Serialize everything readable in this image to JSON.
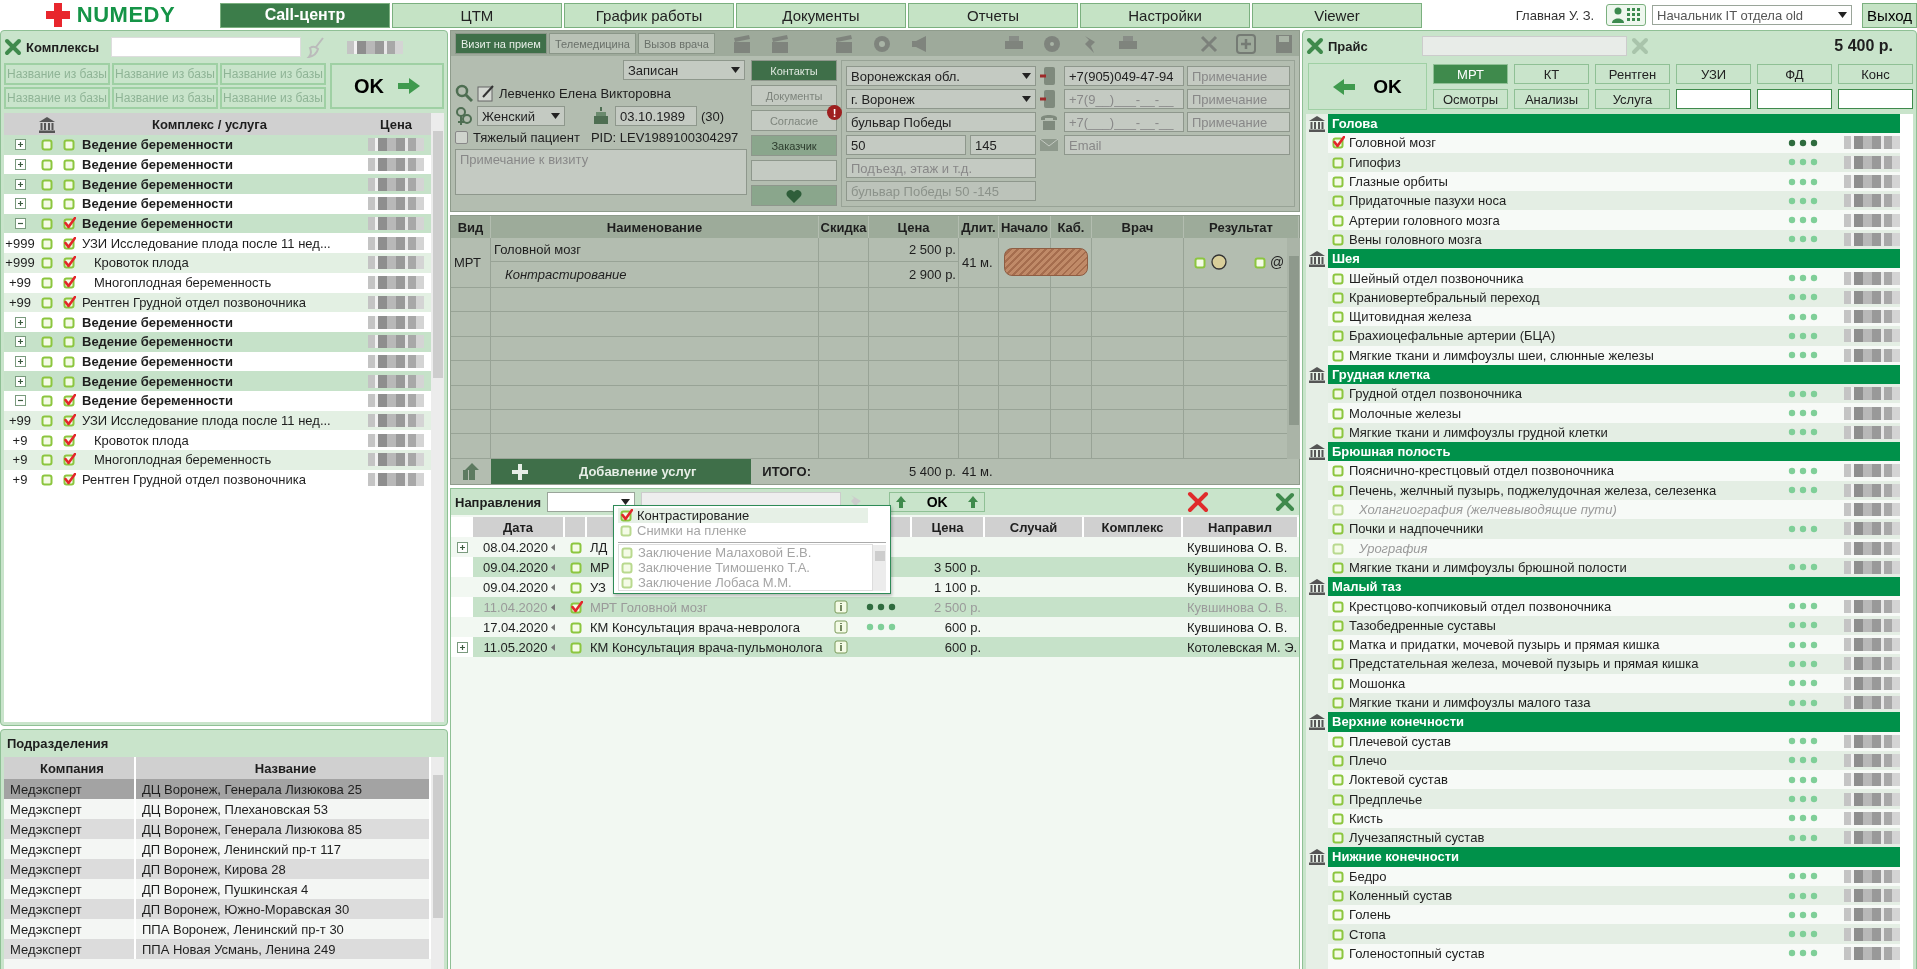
{
  "header": {
    "logo": "NUMEDY",
    "nav": [
      {
        "label": "Call-центр",
        "selected": true
      },
      {
        "label": "ЦТМ",
        "selected": false
      },
      {
        "label": "График работы",
        "selected": false
      },
      {
        "label": "Документы",
        "selected": false
      },
      {
        "label": "Отчеты",
        "selected": false
      },
      {
        "label": "Настройки",
        "selected": false
      },
      {
        "label": "Viewer",
        "selected": false
      }
    ],
    "user": "Главная У. З.",
    "role": "Начальник IT отдела old",
    "logout": "Выход"
  },
  "complexes": {
    "title": "Комплексы",
    "quick_buttons": [
      "Название из базы",
      "Название из базы",
      "Название из базы",
      "Название из базы",
      "Название из базы",
      "Название из базы"
    ],
    "ok": "OK",
    "columns": [
      "Комплекс / услуга",
      "Цена"
    ],
    "rows": [
      {
        "kind": "group",
        "name": "Ведение беременности",
        "checked": false,
        "expanded": false
      },
      {
        "kind": "group",
        "name": "Ведение беременности",
        "checked": false,
        "expanded": false
      },
      {
        "kind": "group",
        "name": "Ведение беременности",
        "checked": false,
        "expanded": false
      },
      {
        "kind": "group",
        "name": "Ведение беременности",
        "checked": false,
        "expanded": false
      },
      {
        "kind": "group",
        "name": "Ведение беременности",
        "checked": true,
        "expanded": true,
        "children": [
          {
            "kind": "service",
            "count": "+999",
            "name": "УЗИ Исследование плода после 11 нед...",
            "checked": true,
            "children": [
              {
                "kind": "service",
                "count": "+999",
                "name": "Кровоток плода",
                "checked": true
              },
              {
                "kind": "service",
                "count": "+99",
                "name": "Многоплодная беременность",
                "checked": true
              }
            ]
          },
          {
            "kind": "service",
            "count": "+99",
            "name": "Рентген Грудной отдел позвоночника",
            "checked": true
          }
        ]
      },
      {
        "kind": "group",
        "name": "Ведение беременности",
        "checked": false,
        "expanded": false
      },
      {
        "kind": "group",
        "name": "Ведение беременности",
        "checked": false,
        "expanded": false
      },
      {
        "kind": "group",
        "name": "Ведение беременности",
        "checked": false,
        "expanded": false
      },
      {
        "kind": "group",
        "name": "Ведение беременности",
        "checked": false,
        "expanded": false
      },
      {
        "kind": "group",
        "name": "Ведение беременности",
        "checked": true,
        "expanded": true,
        "children": [
          {
            "kind": "service",
            "count": "+99",
            "name": "УЗИ Исследование плода после 11 нед...",
            "checked": true,
            "children": [
              {
                "kind": "service",
                "count": "+9",
                "name": "Кровоток плода",
                "checked": true
              },
              {
                "kind": "service",
                "count": "+9",
                "name": "Многоплодная беременность",
                "checked": true
              }
            ]
          },
          {
            "kind": "service",
            "count": "+9",
            "name": "Рентген Грудной отдел позвоночника",
            "checked": true
          }
        ]
      }
    ]
  },
  "divisions": {
    "title": "Подразделения",
    "columns": [
      "Компания",
      "Название"
    ],
    "rows": [
      {
        "company": "Медэксперт",
        "name": "ДЦ Воронеж, Генерала Лизюкова 25",
        "selected": true
      },
      {
        "company": "Медэксперт",
        "name": "ДЦ Воронеж, Плехановская 53",
        "selected": false
      },
      {
        "company": "Медэксперт",
        "name": "ДЦ Воронеж, Генерала Лизюкова 85",
        "selected": false
      },
      {
        "company": "Медэксперт",
        "name": "ДП Воронеж, Ленинский пр-т 117",
        "selected": false
      },
      {
        "company": "Медэксперт",
        "name": "ДП Воронеж, Кирова 28",
        "selected": false
      },
      {
        "company": "Медэксперт",
        "name": "ДП Воронеж, Пушкинская 4",
        "selected": false
      },
      {
        "company": "Медэксперт",
        "name": "ДП Воронеж, Южно-Моравская 30",
        "selected": false
      },
      {
        "company": "Медэксперт",
        "name": "ППА Воронеж, Ленинский пр-т 30",
        "selected": false
      },
      {
        "company": "Медэксперт",
        "name": "ППА Новая Усмань, Ленина 249",
        "selected": false
      }
    ]
  },
  "visit": {
    "tabs": [
      {
        "label": "Визит на прием",
        "selected": true
      },
      {
        "label": "Телемедицина",
        "selected": false
      },
      {
        "label": "Вызов врача",
        "selected": false
      }
    ],
    "status": "Записан",
    "patient": "Левченко Елена Викторовна",
    "gender": "Женский",
    "birth_date": "03.10.1989",
    "age": "(30)",
    "heavy_patient": {
      "label": "Тяжелый пациент",
      "checked": false
    },
    "pid": "PID: LEV1989100304297",
    "note_placeholder": "Примечание к визиту",
    "side_buttons": [
      {
        "kind": "tab",
        "label": "Контакты",
        "selected": true
      },
      {
        "kind": "tab",
        "label": "Документы",
        "selected": false
      },
      {
        "kind": "tab",
        "label": "Согласие",
        "selected": false,
        "alert": "!"
      },
      {
        "kind": "action",
        "label": "Заказчик"
      }
    ],
    "address": {
      "region": "Воронежская обл.",
      "city": "г. Воронеж",
      "street": "бульвар Победы",
      "house": "50",
      "apartment": "145",
      "entrance_placeholder": "Подъезд, этаж и т.д.",
      "full": "бульвар Победы 50 -145"
    },
    "contacts": [
      {
        "kind": "mobile",
        "value": "+7(905)049-47-94",
        "note_placeholder": "Примечание"
      },
      {
        "kind": "mobile",
        "placeholder": "+7(9__)___-__-__",
        "note_placeholder": "Примечание"
      },
      {
        "kind": "landline",
        "placeholder": "+7(___)___-__-__",
        "note_placeholder": "Примечание"
      }
    ],
    "email_placeholder": "Email"
  },
  "services": {
    "columns": [
      "Вид",
      "Наименование",
      "Скидка",
      "Цена",
      "Длит.",
      "Начало",
      "Каб.",
      "Врач",
      "Результат"
    ],
    "rows": [
      {
        "type": "МРТ",
        "name": "Головной мозг",
        "price": "2 500 р.",
        "duration": "41 м.",
        "booked": true,
        "email_mark": "@",
        "options": [
          {
            "name": "Контрастирование",
            "price": "2 900 р."
          }
        ]
      }
    ],
    "add_button": "Добавление услуг",
    "total_label": "ИТОГО:",
    "total": "5 400 р.",
    "total_duration": "41 м."
  },
  "directions": {
    "title": "Направления",
    "ok": "OK",
    "columns": {
      "date": "Дата",
      "price": "Цена",
      "case": "Случай",
      "complex": "Комплекс",
      "referrer": "Направил"
    },
    "rows": [
      {
        "date": "08.04.2020",
        "expandable": true,
        "checked": false,
        "name": "ЛД",
        "referrer": "Кувшинова О. В."
      },
      {
        "date": "09.04.2020",
        "checked": false,
        "name": "МР",
        "price": "3 500 р.",
        "referrer": "Кувшинова О. В."
      },
      {
        "date": "09.04.2020",
        "checked": false,
        "name": "УЗ",
        "price": "1 100 р.",
        "referrer": "Кувшинова О. В."
      },
      {
        "date": "11.04.2020",
        "checked": true,
        "disabled": true,
        "name": "МРТ Головной мозг",
        "info": true,
        "dots_active": true,
        "price": "2 500 р.",
        "referrer": "Кувшинова О. В."
      },
      {
        "date": "17.04.2020",
        "checked": false,
        "name": "КМ Консультация врача-невролога",
        "info": true,
        "dots_active": false,
        "price": "600 р.",
        "referrer": "Кувшинова О. В."
      },
      {
        "date": "11.05.2020",
        "expandable": true,
        "checked": false,
        "name": "КМ Консультация врача-пульмонолога",
        "info": true,
        "price": "600 р.",
        "referrer": "Котолевская М. Э."
      }
    ],
    "popup": {
      "options": [
        {
          "label": "Контрастирование",
          "checked": true,
          "disabled": false
        },
        {
          "label": "Снимки на пленке",
          "checked": false,
          "disabled": true
        }
      ],
      "reports": [
        {
          "label": "Заключение Малаховой Е.В.",
          "checked": false,
          "disabled": true
        },
        {
          "label": "Заключение Тимошенко Т.А.",
          "checked": false,
          "disabled": true
        },
        {
          "label": "Заключение Лобаса М.М.",
          "checked": false,
          "disabled": true
        }
      ]
    }
  },
  "price": {
    "title": "Прайс",
    "total": "5 400 р.",
    "ok": "OK",
    "tabs": [
      {
        "label": "МРТ",
        "selected": true
      },
      {
        "label": "КТ",
        "selected": false
      },
      {
        "label": "Рентген",
        "selected": false
      },
      {
        "label": "УЗИ",
        "selected": false
      },
      {
        "label": "ФД",
        "selected": false
      },
      {
        "label": "Конс",
        "selected": false
      },
      {
        "label": "Осмотры",
        "selected": false
      },
      {
        "label": "Анализы",
        "selected": false
      },
      {
        "label": "Услуга",
        "selected": false
      }
    ],
    "sections": [
      {
        "title": "Голова",
        "items": [
          {
            "kind": "service",
            "name": "Головной мозг",
            "checked": true,
            "dots_active": true
          },
          {
            "kind": "service",
            "name": "Гипофиз",
            "checked": false,
            "dots_active": false
          },
          {
            "kind": "service",
            "name": "Глазные орбиты",
            "checked": false,
            "dots_active": false
          },
          {
            "kind": "service",
            "name": "Придаточные пазухи носа",
            "checked": false,
            "dots_active": false
          },
          {
            "kind": "service",
            "name": "Артерии головного мозга",
            "checked": false,
            "dots_active": false
          },
          {
            "kind": "service",
            "name": "Вены головного мозга",
            "checked": false,
            "dots_active": false
          }
        ]
      },
      {
        "title": "Шея",
        "items": [
          {
            "kind": "service",
            "name": "Шейный отдел позвоночника",
            "checked": false,
            "dots_active": false
          },
          {
            "kind": "service",
            "name": "Краниовертебральный переход",
            "checked": false,
            "dots_active": false
          },
          {
            "kind": "service",
            "name": "Щитовидная железа",
            "checked": false,
            "dots_active": false
          },
          {
            "kind": "service",
            "name": "Брахиоцефальные артерии (БЦА)",
            "checked": false,
            "dots_active": false
          },
          {
            "kind": "service",
            "name": "Мягкие ткани и лимфоузлы шеи, слюнные железы",
            "checked": false,
            "dots_active": false
          }
        ]
      },
      {
        "title": "Грудная клетка",
        "items": [
          {
            "kind": "service",
            "name": "Грудной отдел позвоночника",
            "checked": false,
            "dots_active": false
          },
          {
            "kind": "service",
            "name": "Молочные железы",
            "checked": false,
            "dots_active": false
          },
          {
            "kind": "service",
            "name": "Мягкие ткани и лимфоузлы грудной клетки",
            "checked": false,
            "dots_active": false
          }
        ]
      },
      {
        "title": "Брюшная полость",
        "items": [
          {
            "kind": "service",
            "name": "Пояснично-крестцовый отдел позвоночника",
            "checked": false,
            "dots_active": false
          },
          {
            "kind": "service",
            "name": "Печень, желчный пузырь, поджелудочная железа, селезенка",
            "checked": false,
            "dots_active": false
          },
          {
            "kind": "option",
            "name": "Холангиография (желчевыводящие пути)",
            "checked": false
          },
          {
            "kind": "service",
            "name": "Почки и надпочечники",
            "checked": false,
            "dots_active": false
          },
          {
            "kind": "option",
            "name": "Урография",
            "checked": false
          },
          {
            "kind": "service",
            "name": "Мягкие ткани и лимфоузлы брюшной полости",
            "checked": false,
            "dots_active": false
          }
        ]
      },
      {
        "title": "Малый таз",
        "items": [
          {
            "kind": "service",
            "name": "Крестцово-копчиковый отдел позвоночника",
            "checked": false,
            "dots_active": false
          },
          {
            "kind": "service",
            "name": "Тазобедренные суставы",
            "checked": false,
            "dots_active": false
          },
          {
            "kind": "service",
            "name": "Матка и придатки, мочевой пузырь и прямая кишка",
            "checked": false,
            "dots_active": false
          },
          {
            "kind": "service",
            "name": "Предстательная железа, мочевой пузырь и прямая кишка",
            "checked": false,
            "dots_active": false
          },
          {
            "kind": "service",
            "name": "Мошонка",
            "checked": false,
            "dots_active": false
          },
          {
            "kind": "service",
            "name": "Мягкие ткани и лимфоузлы малого таза",
            "checked": false,
            "dots_active": false
          }
        ]
      },
      {
        "title": "Верхние конечности",
        "items": [
          {
            "kind": "service",
            "name": "Плечевой сустав",
            "checked": false,
            "dots_active": false
          },
          {
            "kind": "service",
            "name": "Плечо",
            "checked": false,
            "dots_active": false
          },
          {
            "kind": "service",
            "name": "Локтевой сустав",
            "checked": false,
            "dots_active": false
          },
          {
            "kind": "service",
            "name": "Предплечье",
            "checked": false,
            "dots_active": false
          },
          {
            "kind": "service",
            "name": "Кисть",
            "checked": false,
            "dots_active": false
          },
          {
            "kind": "service",
            "name": "Лучезапястный сустав",
            "checked": false,
            "dots_active": false
          }
        ]
      },
      {
        "title": "Нижние конечности",
        "items": [
          {
            "kind": "service",
            "name": "Бедро",
            "checked": false,
            "dots_active": false
          },
          {
            "kind": "service",
            "name": "Коленный сустав",
            "checked": false,
            "dots_active": false
          },
          {
            "kind": "service",
            "name": "Голень",
            "checked": false,
            "dots_active": false
          },
          {
            "kind": "service",
            "name": "Стопа",
            "checked": false,
            "dots_active": false
          },
          {
            "kind": "service",
            "name": "Голеностопный сустав",
            "checked": false,
            "dots_active": false
          }
        ]
      }
    ]
  }
}
